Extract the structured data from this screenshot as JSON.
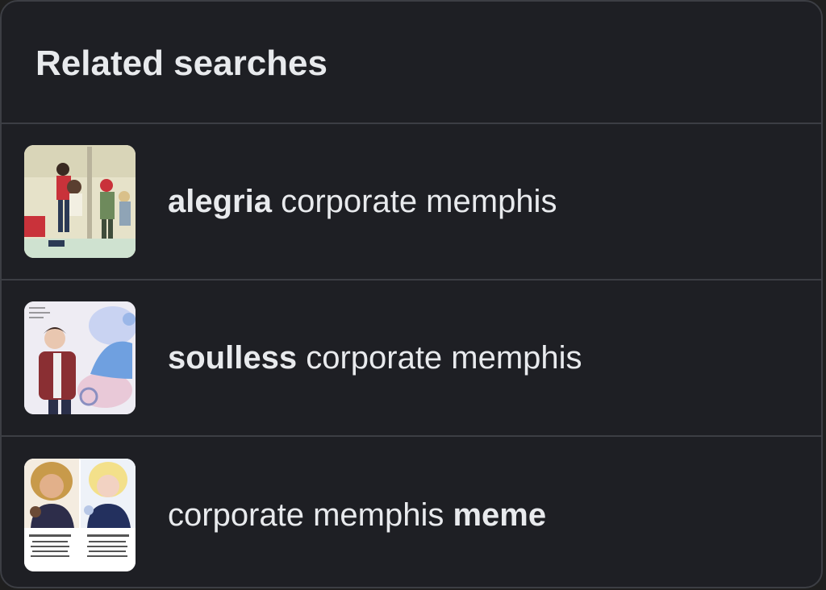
{
  "panel": {
    "title": "Related searches"
  },
  "items": [
    {
      "bold": "alegria",
      "rest": " corporate memphis",
      "thumb_icon": "illustration-thumbnail"
    },
    {
      "bold": "soulless",
      "rest": " corporate memphis",
      "thumb_icon": "illustration-thumbnail"
    },
    {
      "lead": "corporate memphis ",
      "bold": "meme",
      "thumb_icon": "illustration-thumbnail"
    }
  ]
}
